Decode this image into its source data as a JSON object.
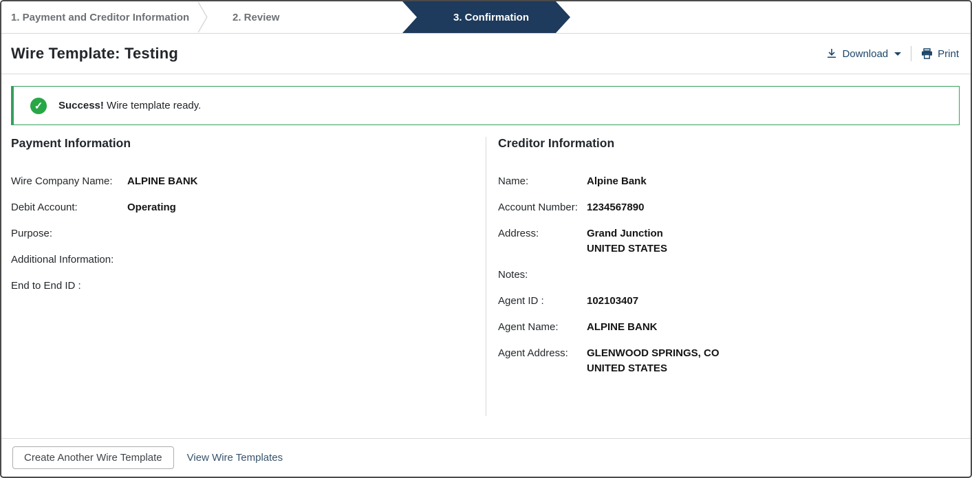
{
  "steps": {
    "step1": "1. Payment and Creditor Information",
    "step2": "2. Review",
    "step3": "3. Confirmation"
  },
  "header": {
    "title": "Wire Template: Testing",
    "download_label": "Download",
    "print_label": "Print"
  },
  "alert": {
    "title": "Success!",
    "message": "Wire template ready."
  },
  "payment_info": {
    "heading": "Payment Information",
    "fields": [
      {
        "label": "Wire Company Name:",
        "value": "ALPINE BANK"
      },
      {
        "label": "Debit Account:",
        "value": "Operating"
      },
      {
        "label": "Purpose:",
        "value": ""
      },
      {
        "label": "Additional Information:",
        "value": ""
      },
      {
        "label": "End to End ID :",
        "value": ""
      }
    ]
  },
  "creditor_info": {
    "heading": "Creditor Information",
    "fields": [
      {
        "label": "Name:",
        "value": "Alpine Bank"
      },
      {
        "label": "Account Number:",
        "value": "1234567890"
      },
      {
        "label": "Address:",
        "value": "Grand Junction",
        "value2": "UNITED STATES"
      },
      {
        "label": "Notes:",
        "value": ""
      },
      {
        "label": "Agent ID :",
        "value": "102103407"
      },
      {
        "label": "Agent Name:",
        "value": "ALPINE BANK"
      },
      {
        "label": "Agent Address:",
        "value": "GLENWOOD SPRINGS, CO",
        "value2": "UNITED STATES"
      }
    ]
  },
  "footer": {
    "create_button": "Create Another Wire Template",
    "view_link": "View Wire Templates"
  },
  "icons": {
    "success": "success-check-icon",
    "download": "download-icon",
    "caret": "caret-down-icon",
    "print": "print-icon"
  },
  "colors": {
    "active_step_bg": "#1e3a5c",
    "success_green": "#27a745",
    "success_border": "#35a05e",
    "action_link": "#1d4568",
    "step_text_gray": "#6d7175"
  }
}
